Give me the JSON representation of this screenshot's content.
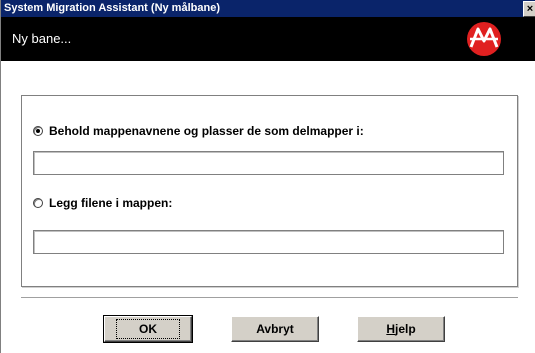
{
  "window": {
    "title": "System Migration Assistant (Ny målbane)",
    "close_glyph": "×"
  },
  "header": {
    "title": "Ny bane...",
    "logo_icon": "sma-logo-icon",
    "logo_color": "#e02020"
  },
  "options": {
    "keep_names": {
      "label": "Behold mappenavnene og plasser de som delmapper i:",
      "selected": true,
      "field_value": ""
    },
    "put_in_folder": {
      "label": "Legg filene i mappen:",
      "selected": false,
      "field_value": ""
    }
  },
  "buttons": {
    "ok": "OK",
    "cancel": "Avbryt",
    "help_first": "H",
    "help_rest": "jelp"
  }
}
